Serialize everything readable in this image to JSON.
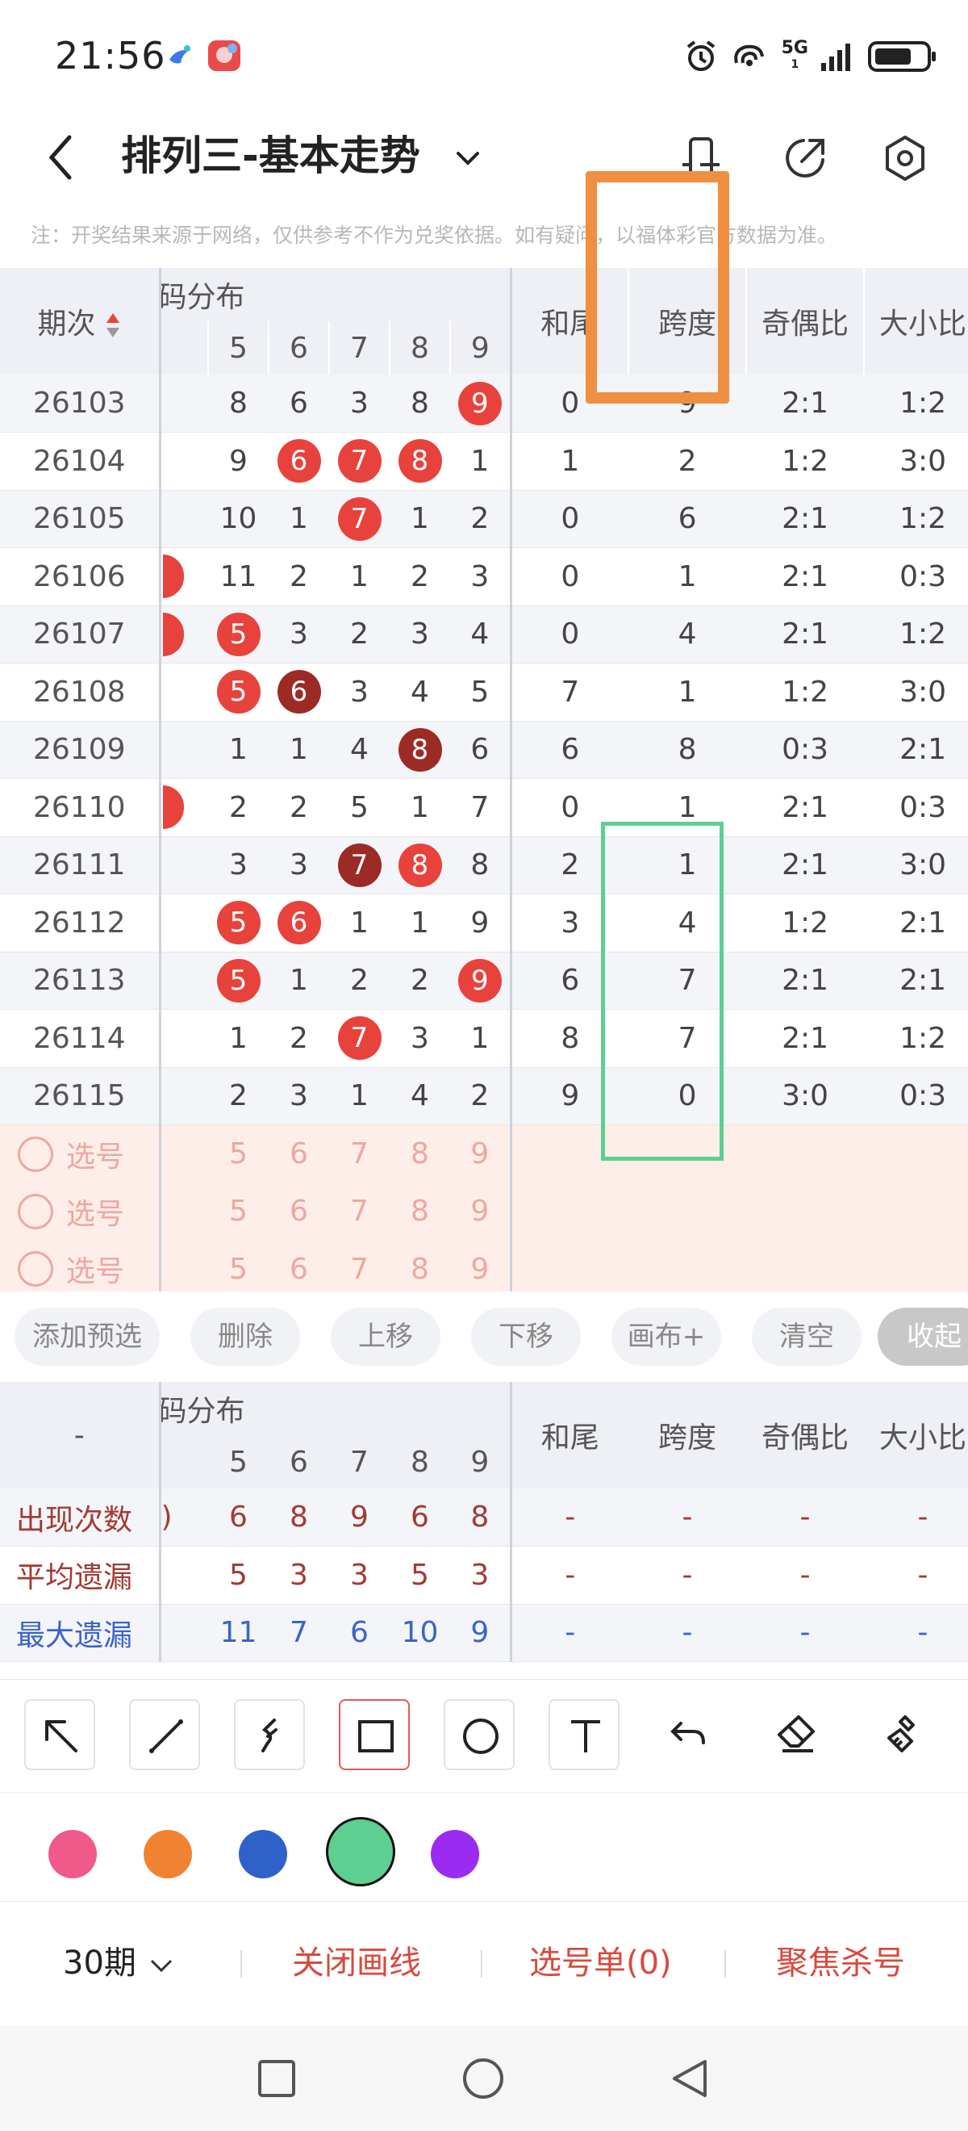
{
  "status_bar": {
    "time": "21:56",
    "network": "5G",
    "sim": "1"
  },
  "header": {
    "title": "排列三-基本走势"
  },
  "notice": "注：开奖结果来源于网络，仅供参考不作为兑奖依据。如有疑问，以福体彩官方数据为准。",
  "table": {
    "col_period": "期次",
    "col_dist": "号码分布",
    "col_dist_visible": "号码分布",
    "digits": [
      "5",
      "6",
      "7",
      "8",
      "9"
    ],
    "col_hewei": "和尾",
    "col_kuadu": "跨度",
    "col_jiou": "奇偶比",
    "col_daxiao": "大小比",
    "rows": [
      {
        "period": "26103",
        "d": [
          "8",
          "6",
          "3",
          "8",
          "9"
        ],
        "hewei": "0",
        "kuadu": "9",
        "jiou": "2:1",
        "daxiao": "1:2"
      },
      {
        "period": "26104",
        "d": [
          "9",
          "6",
          "7",
          "8",
          "1"
        ],
        "hewei": "1",
        "kuadu": "2",
        "jiou": "1:2",
        "daxiao": "3:0"
      },
      {
        "period": "26105",
        "d": [
          "10",
          "1",
          "7",
          "1",
          "2"
        ],
        "hewei": "0",
        "kuadu": "6",
        "jiou": "2:1",
        "daxiao": "1:2"
      },
      {
        "period": "26106",
        "d": [
          "11",
          "2",
          "1",
          "2",
          "3"
        ],
        "hewei": "0",
        "kuadu": "1",
        "jiou": "2:1",
        "daxiao": "0:3"
      },
      {
        "period": "26107",
        "d": [
          "5",
          "3",
          "2",
          "3",
          "4"
        ],
        "hewei": "0",
        "kuadu": "4",
        "jiou": "2:1",
        "daxiao": "1:2"
      },
      {
        "period": "26108",
        "d": [
          "5",
          "6",
          "3",
          "4",
          "5"
        ],
        "hewei": "7",
        "kuadu": "1",
        "jiou": "1:2",
        "daxiao": "3:0"
      },
      {
        "period": "26109",
        "d": [
          "1",
          "1",
          "4",
          "8",
          "6"
        ],
        "hewei": "6",
        "kuadu": "8",
        "jiou": "0:3",
        "daxiao": "2:1"
      },
      {
        "period": "26110",
        "d": [
          "2",
          "2",
          "5",
          "1",
          "7"
        ],
        "hewei": "0",
        "kuadu": "1",
        "jiou": "2:1",
        "daxiao": "0:3"
      },
      {
        "period": "26111",
        "d": [
          "3",
          "3",
          "7",
          "8",
          "8"
        ],
        "hewei": "2",
        "kuadu": "1",
        "jiou": "2:1",
        "daxiao": "3:0"
      },
      {
        "period": "26112",
        "d": [
          "5",
          "6",
          "1",
          "1",
          "9"
        ],
        "hewei": "3",
        "kuadu": "4",
        "jiou": "1:2",
        "daxiao": "2:1"
      },
      {
        "period": "26113",
        "d": [
          "5",
          "1",
          "2",
          "2",
          "9"
        ],
        "hewei": "6",
        "kuadu": "7",
        "jiou": "2:1",
        "daxiao": "2:1"
      },
      {
        "period": "26114",
        "d": [
          "1",
          "2",
          "7",
          "3",
          "1"
        ],
        "hewei": "8",
        "kuadu": "7",
        "jiou": "2:1",
        "daxiao": "1:2"
      },
      {
        "period": "26115",
        "d": [
          "2",
          "3",
          "1",
          "4",
          "2"
        ],
        "hewei": "9",
        "kuadu": "0",
        "jiou": "3:0",
        "daxiao": "0:3"
      }
    ],
    "pick_label": "选号"
  },
  "actions": {
    "add_preselect": "添加预选",
    "delete": "删除",
    "move_up": "上移",
    "move_down": "下移",
    "canvas_plus": "画布+",
    "clear": "清空",
    "collapse": "收起"
  },
  "stats": {
    "first_col": "-",
    "rows": [
      {
        "label": "出现次数",
        "vals": [
          "6",
          "8",
          "9",
          "6",
          "8"
        ],
        "lead": ")",
        "rest": [
          "-",
          "-",
          "-",
          "-"
        ],
        "color": "red"
      },
      {
        "label": "平均遗漏",
        "vals": [
          "5",
          "3",
          "3",
          "5",
          "3"
        ],
        "rest": [
          "-",
          "-",
          "-",
          "-"
        ],
        "color": "red"
      },
      {
        "label": "最大遗漏",
        "vals": [
          "11",
          "7",
          "6",
          "10",
          "9"
        ],
        "rest": [
          "-",
          "-",
          "-",
          "-"
        ],
        "color": "blue"
      }
    ]
  },
  "draw_tools": [
    "arrow-icon",
    "line-icon",
    "curve-icon",
    "rectangle-icon",
    "ellipse-icon",
    "text-icon",
    "undo-icon",
    "eraser-icon",
    "clear-brush-icon"
  ],
  "colors": [
    "#ef5a8a",
    "#f08232",
    "#2e62c9",
    "#5ccf91",
    "#9b2bf0"
  ],
  "bottom_bar": {
    "period_select": "30期",
    "close_drawing": "关闭画线",
    "pick_list": "选号单(0)",
    "focus_kill": "聚焦杀号"
  }
}
